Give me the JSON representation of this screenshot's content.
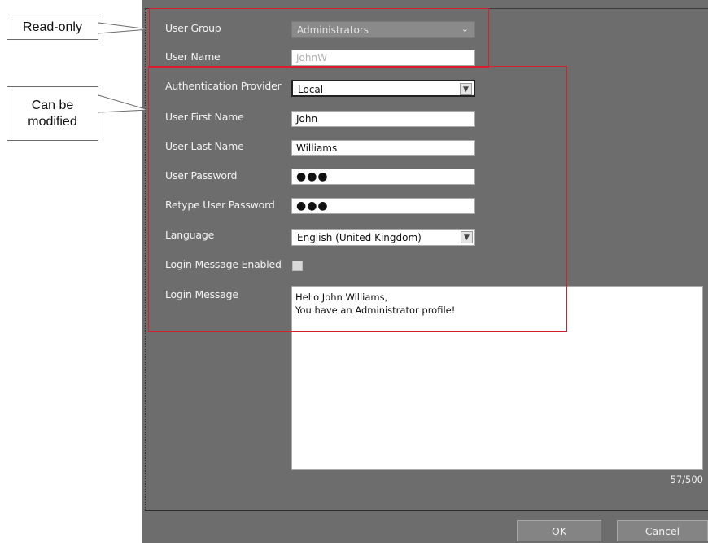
{
  "callouts": {
    "readonly": "Read-only",
    "modify": "Can be\nmodified"
  },
  "form": {
    "user_group": {
      "label": "User Group",
      "value": "Administrators"
    },
    "user_name": {
      "label": "User Name",
      "value": "JohnW"
    },
    "auth_provider": {
      "label": "Authentication Provider",
      "value": "Local"
    },
    "first_name": {
      "label": "User First Name",
      "value": "John"
    },
    "last_name": {
      "label": "User Last Name",
      "value": "Williams"
    },
    "password": {
      "label": "User Password",
      "value": "●●●"
    },
    "retype_password": {
      "label": "Retype User Password",
      "value": "●●●"
    },
    "language": {
      "label": "Language",
      "value": "English (United Kingdom)"
    },
    "login_message_enabled": {
      "label": "Login Message Enabled",
      "checked": false
    },
    "login_message": {
      "label": "Login Message",
      "line1": "Hello John Williams,",
      "line2": "You have an Administrator profile!",
      "counter": "57/500"
    }
  },
  "buttons": {
    "ok": "OK",
    "cancel": "Cancel"
  },
  "colors": {
    "dialog_bg": "#6d6d6d",
    "highlight": "#d81e28"
  }
}
